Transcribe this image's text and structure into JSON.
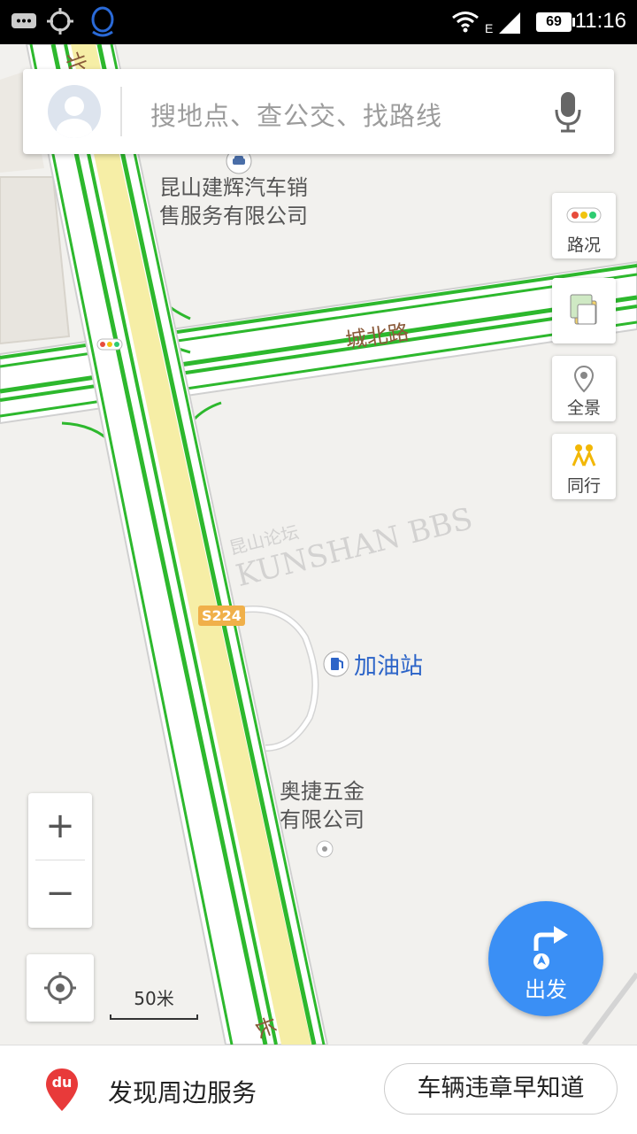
{
  "status_bar": {
    "time": "11:16",
    "battery": "69",
    "network": "E"
  },
  "search": {
    "placeholder": "搜地点、查公交、找路线"
  },
  "side_buttons": {
    "traffic": "路况",
    "panorama": "全景",
    "travel_together": "同行"
  },
  "map": {
    "road_chengbei": "城北路",
    "road_shield": "S224",
    "road_chang": "长",
    "road_top_fragment": "北",
    "poi_car_dealer": [
      "昆山建辉汽车销",
      "售服务有限公司"
    ],
    "poi_gas": "加油站",
    "poi_hardware": [
      "奥捷五金",
      "有限公司"
    ],
    "watermark_cn": "昆山论坛",
    "watermark_en": "KUNSHAN BBS"
  },
  "zoom": {
    "plus": "+",
    "minus": "−"
  },
  "scale": {
    "label": "50米"
  },
  "go_button": {
    "label": "出发"
  },
  "bottom_bar": {
    "nearby": "发现周边服务",
    "violation": "车辆违章早知道",
    "logo": "du"
  },
  "colors": {
    "traffic_green": "#2db82d",
    "road_yellow": "#f6eea6",
    "accent_blue": "#3a8ff5",
    "poi_blue": "#2c64c8",
    "logo_red": "#e83a3a"
  }
}
